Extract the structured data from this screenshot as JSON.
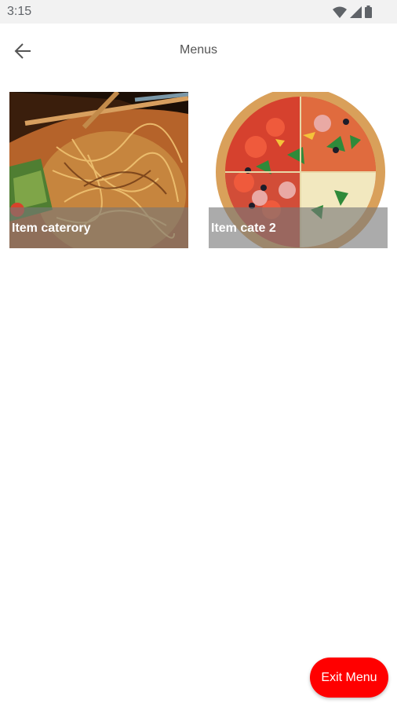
{
  "status_bar": {
    "time": "3:15",
    "icons": [
      "wifi-icon",
      "signal-icon",
      "battery-icon"
    ]
  },
  "app_bar": {
    "back_icon": "arrow-left-icon",
    "title": "Menus"
  },
  "categories": [
    {
      "label": "Item caterory",
      "image": "noodles-photo"
    },
    {
      "label": "Item cate 2",
      "image": "pizza-photo"
    }
  ],
  "exit_button": {
    "label": "Exit Menu",
    "color": "#ff0000"
  }
}
